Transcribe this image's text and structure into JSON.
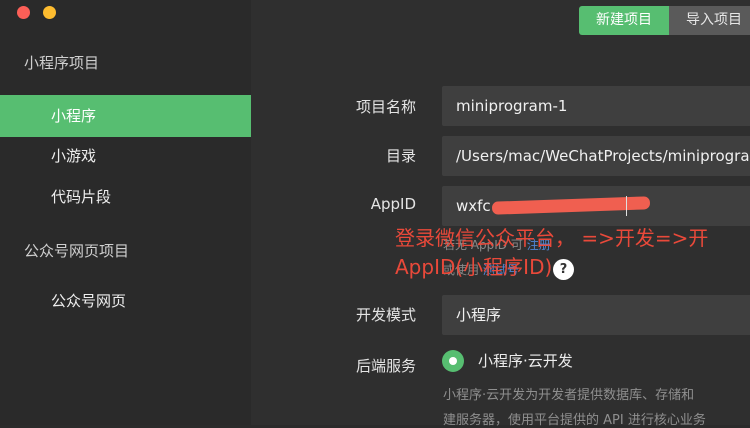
{
  "sidebar": {
    "section1_title": "小程序项目",
    "items": [
      {
        "label": "小程序",
        "active": true
      },
      {
        "label": "小游戏",
        "active": false
      },
      {
        "label": "代码片段",
        "active": false
      }
    ],
    "section2_title": "公众号网页项目",
    "items2": [
      {
        "label": "公众号网页",
        "active": false
      }
    ]
  },
  "header": {
    "new_project_label": "新建项目",
    "import_project_label": "导入项目"
  },
  "form": {
    "name_label": "项目名称",
    "name_value": "miniprogram-1",
    "dir_label": "目录",
    "dir_value": "/Users/mac/WeChatProjects/miniprogra",
    "appid_label": "AppID",
    "appid_value": "wxfc",
    "hint_line1_prefix": "若无 AppID 可",
    "hint_line1_link": "注册",
    "hint_line2_prefix": "或使用",
    "hint_line2_link": "测试号",
    "qmark": "?",
    "mode_label": "开发模式",
    "mode_value": "小程序",
    "backend_label": "后端服务",
    "backend_option": "小程序·云开发",
    "desc_line1": "小程序·云开发为开发者提供数据库、存储和",
    "desc_line2": "建服务器，使用平台提供的 API 进行核心业务"
  },
  "annotation": {
    "line1": "登录微信公众平台， =>开发=>开",
    "line2": "AppID(小程序ID)"
  },
  "colors": {
    "accent": "#57be71",
    "annotation": "#e9493a",
    "link": "#4f86d6"
  }
}
